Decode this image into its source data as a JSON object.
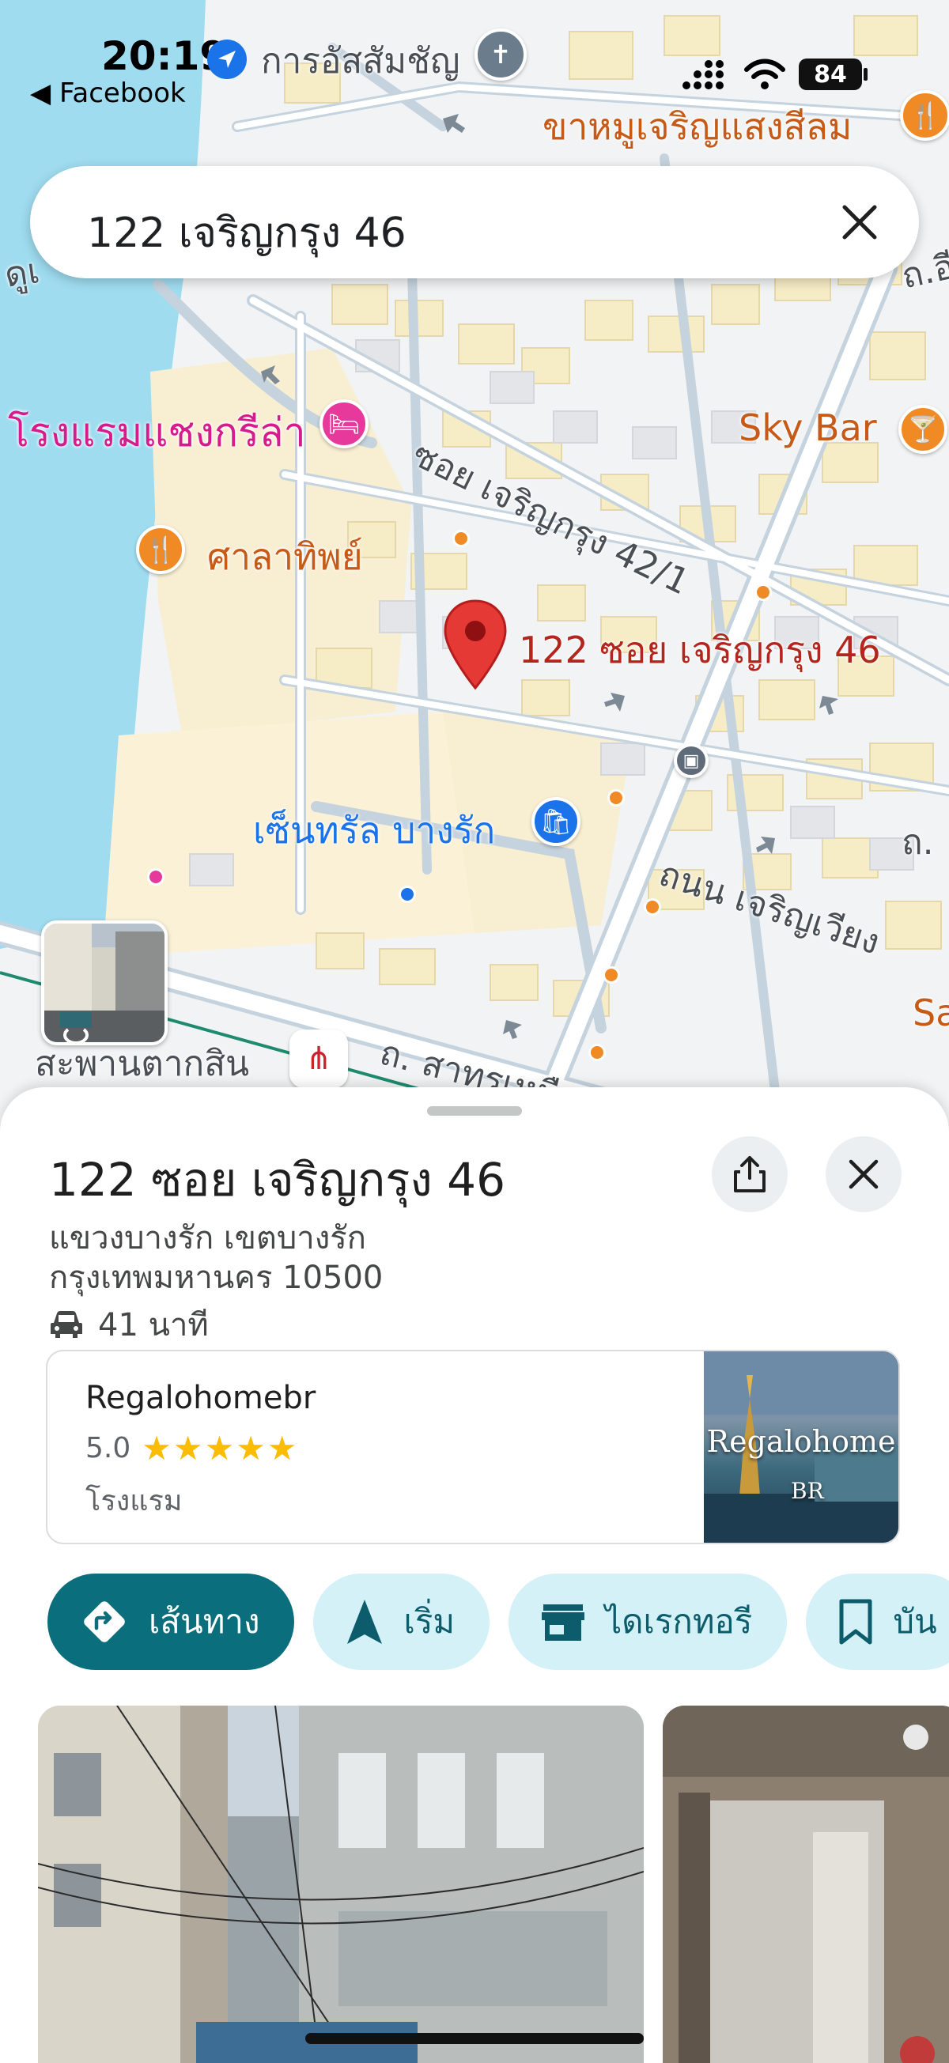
{
  "status_bar": {
    "time": "20:19",
    "back_app": "◀ Facebook",
    "battery": "84"
  },
  "search": {
    "query": "122 เจริญกรุง 46"
  },
  "map_labels": {
    "temple": "การอัสสัมชัญ",
    "restaurant_top": "ขาหมูเจริญแสงสีลม",
    "dusit": "ดูเ",
    "road_right": "ถ.อี",
    "hotel_pink": "โรงแรมแชงกรีล่า",
    "soi_42": "ซอย เจริญกรุง 42/1",
    "sky_bar": "Sky Bar",
    "sala": "ศาลาทิพย์",
    "pin_label": "122 ซอย เจริญกรุง 46",
    "central": "เซ็นทรัล บางรัก",
    "charoen_wiang": "ถนน เจริญเวียง",
    "road_small": "ถ.",
    "taksin": "สะพานตากสิน",
    "sathorn": "ถ. สาทรเหนือ",
    "sa": "Sa"
  },
  "place": {
    "title": "122 ซอย เจริญกรุง 46",
    "address_line1": "แขวงบางรัก เขตบางรัก",
    "address_line2": "กรุงเทพมหานคร 10500",
    "drive_time": "41 นาที"
  },
  "hotel_card": {
    "name": "Regalohomebr",
    "rating": "5.0",
    "stars": "★★★★★",
    "type": "โรงแรม",
    "image_text": "Regalohome",
    "image_sub": "BR"
  },
  "actions": {
    "directions": "เส้นทาง",
    "start": "เริ่ม",
    "directory": "ไดเรกทอรี",
    "save": "บัน"
  },
  "colors": {
    "primary": "#0b6e7c",
    "pill_bg": "#d3f1f7",
    "pin_red": "#e53935",
    "water": "#9fdcf0"
  }
}
